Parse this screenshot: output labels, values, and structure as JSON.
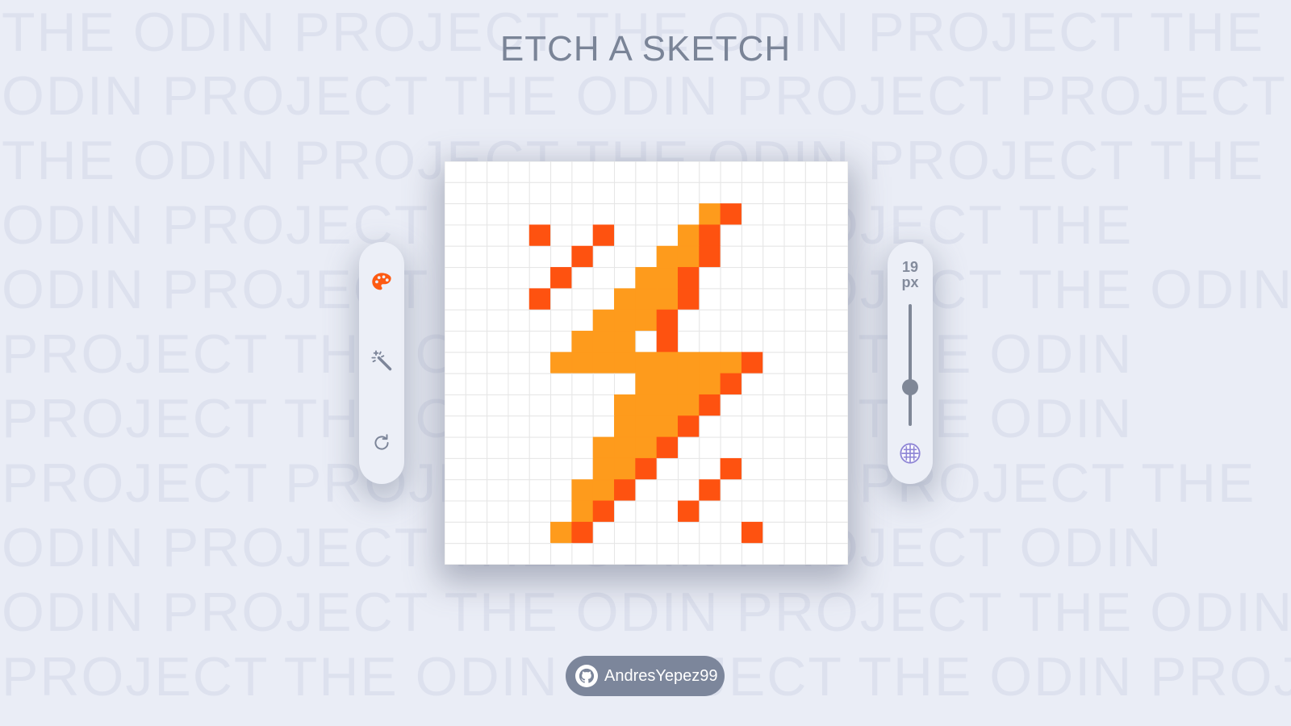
{
  "background_words": [
    "THE  ODIN  PROJECT  THE  ODIN  PROJECT  THE",
    "ODIN  PROJECT  THE  ODIN  PROJECT  PROJECT",
    "THE  ODIN  PROJECT  THE  ODIN  PROJECT  THE",
    "ODIN    PROJECT  THE  ODIN  PROJECT    THE",
    "ODIN  PROJECT  THE  ODIN  PROJECT  THE  ODIN",
    "PROJECT     THE  ODIN  PROJECT  THE     ODIN",
    "PROJECT     THE  ODIN  PROJECT  THE     ODIN",
    "PROJECT  PROJECT  THE  ODIN  PROJECT  THE",
    "ODIN    PROJECT  THE  ODIN  PROJECT    ODIN",
    "ODIN  PROJECT  THE  ODIN  PROJECT  THE  ODIN",
    "PROJECT  THE  ODIN  PROJECT  THE  ODIN  PROJEC"
  ],
  "title": "ETCH A SKETCH",
  "left_toolbar": {
    "tools": [
      {
        "name": "color-palette",
        "icon": "palette-icon",
        "active": true,
        "color": "#fd5a12"
      },
      {
        "name": "rainbow-magic",
        "icon": "magic-wand-icon",
        "active": false,
        "color": "#7c8599"
      },
      {
        "name": "reset",
        "icon": "refresh-icon",
        "active": false,
        "color": "#7c8599"
      }
    ]
  },
  "right_toolbar": {
    "size_value": "19",
    "size_unit": "px",
    "slider_level_fraction": 0.68,
    "grid_toggle_icon": "grid-icon",
    "grid_toggle_color": "#8f86d6"
  },
  "canvas": {
    "grid_size": 19,
    "grid_line_color": "#e6e6e6",
    "background": "#ffffff",
    "colors": {
      "yellow": "#fe9b1c",
      "red": "#fe5210"
    },
    "cells_yellow": [
      [
        12,
        2
      ],
      [
        11,
        3
      ],
      [
        10,
        4
      ],
      [
        11,
        4
      ],
      [
        9,
        5
      ],
      [
        10,
        5
      ],
      [
        8,
        6
      ],
      [
        9,
        6
      ],
      [
        10,
        6
      ],
      [
        7,
        7
      ],
      [
        8,
        7
      ],
      [
        9,
        7
      ],
      [
        6,
        8
      ],
      [
        7,
        8
      ],
      [
        8,
        8
      ],
      [
        5,
        9
      ],
      [
        6,
        9
      ],
      [
        7,
        9
      ],
      [
        8,
        9
      ],
      [
        9,
        9
      ],
      [
        10,
        9
      ],
      [
        11,
        9
      ],
      [
        12,
        9
      ],
      [
        13,
        9
      ],
      [
        9,
        10
      ],
      [
        10,
        10
      ],
      [
        11,
        10
      ],
      [
        12,
        10
      ],
      [
        8,
        11
      ],
      [
        9,
        11
      ],
      [
        10,
        11
      ],
      [
        11,
        11
      ],
      [
        8,
        12
      ],
      [
        9,
        12
      ],
      [
        10,
        12
      ],
      [
        7,
        13
      ],
      [
        8,
        13
      ],
      [
        9,
        13
      ],
      [
        7,
        14
      ],
      [
        8,
        14
      ],
      [
        6,
        15
      ],
      [
        7,
        15
      ],
      [
        6,
        16
      ],
      [
        5,
        17
      ]
    ],
    "cells_red": [
      [
        13,
        2
      ],
      [
        4,
        3
      ],
      [
        7,
        3
      ],
      [
        12,
        3
      ],
      [
        6,
        4
      ],
      [
        12,
        4
      ],
      [
        5,
        5
      ],
      [
        11,
        5
      ],
      [
        4,
        6
      ],
      [
        11,
        6
      ],
      [
        10,
        7
      ],
      [
        10,
        8
      ],
      [
        14,
        9
      ],
      [
        13,
        10
      ],
      [
        12,
        11
      ],
      [
        11,
        12
      ],
      [
        10,
        13
      ],
      [
        9,
        14
      ],
      [
        13,
        14
      ],
      [
        8,
        15
      ],
      [
        12,
        15
      ],
      [
        7,
        16
      ],
      [
        11,
        16
      ],
      [
        6,
        17
      ],
      [
        14,
        17
      ]
    ]
  },
  "footer": {
    "github_icon": "github-icon",
    "username": "AndresYepez99"
  }
}
